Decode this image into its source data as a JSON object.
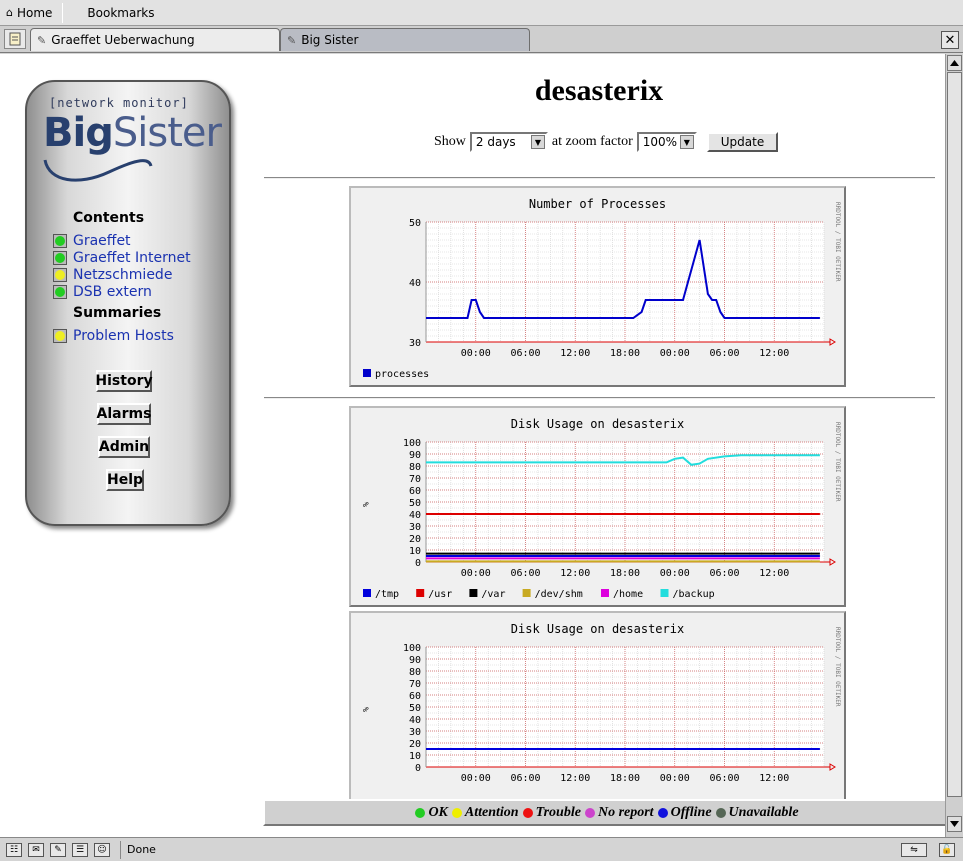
{
  "toolbar": {
    "home_label": "Home",
    "bookmarks_label": "Bookmarks"
  },
  "tabs": [
    {
      "label": "Graeffet Ueberwachung",
      "active": true
    },
    {
      "label": "Big Sister",
      "active": false
    }
  ],
  "sidebar": {
    "logo_tagline": "[network monitor]",
    "logo_big": "Big",
    "logo_sister": "Sister",
    "contents_heading": "Contents",
    "contents": [
      {
        "label": "Graeffet",
        "status_color": "#22cc22"
      },
      {
        "label": "Graeffet Internet",
        "status_color": "#22cc22"
      },
      {
        "label": "Netzschmiede",
        "status_color": "#eeee22"
      },
      {
        "label": "DSB extern",
        "status_color": "#22cc22"
      }
    ],
    "summaries_heading": "Summaries",
    "summaries": [
      {
        "label": "Problem Hosts",
        "status_color": "#eeee22"
      }
    ],
    "buttons": [
      "History",
      "Alarms",
      "Admin",
      "Help"
    ]
  },
  "main": {
    "host": "desasterix",
    "show_label": "Show",
    "range_value": "2 days",
    "zoom_label": "at zoom factor",
    "zoom_value": "100%",
    "update_label": "Update"
  },
  "status_legend": [
    {
      "label": "OK",
      "color": "#22cc22"
    },
    {
      "label": "Attention",
      "color": "#eeee00"
    },
    {
      "label": "Trouble",
      "color": "#ee1111"
    },
    {
      "label": "No report",
      "color": "#cc44cc"
    },
    {
      "label": "Offline",
      "color": "#1111dd"
    },
    {
      "label": "Unavailable",
      "color": "#556655"
    }
  ],
  "statusbar": {
    "text": "Done"
  },
  "chart_data": [
    {
      "type": "line",
      "title": "Number of Processes",
      "side_label": "RRDTOOL / TOBI OETIKER",
      "ylabel": "",
      "ylim": [
        30,
        50
      ],
      "y_ticks": [
        30,
        40,
        50
      ],
      "x_ticks": [
        "00:00",
        "06:00",
        "12:00",
        "18:00",
        "00:00",
        "06:00",
        "12:00"
      ],
      "series": [
        {
          "name": "processes",
          "color": "#0000cc",
          "x": [
            0,
            1,
            2,
            3,
            4,
            5,
            5.5,
            6,
            6.5,
            7,
            8,
            10,
            12,
            14,
            16,
            18,
            20,
            22,
            24,
            25,
            26,
            26.5,
            27,
            28,
            29,
            30,
            31,
            32,
            33,
            34,
            34.5,
            35,
            35.5,
            36,
            37,
            38,
            40,
            42,
            44,
            46,
            47.5
          ],
          "y": [
            34,
            34,
            34,
            34,
            34,
            34,
            37,
            37,
            35,
            34,
            34,
            34,
            34,
            34,
            34,
            34,
            34,
            34,
            34,
            34,
            35,
            37,
            37,
            37,
            37,
            37,
            37,
            42,
            47,
            38,
            37,
            37,
            35,
            34,
            34,
            34,
            34,
            34,
            34,
            34,
            34
          ]
        }
      ]
    },
    {
      "type": "line",
      "title": "Disk Usage on desasterix",
      "side_label": "RRDTOOL / TOBI OETIKER",
      "ylabel": "%",
      "ylim": [
        0,
        100
      ],
      "y_ticks": [
        0,
        10,
        20,
        30,
        40,
        50,
        60,
        70,
        80,
        90,
        100
      ],
      "x_ticks": [
        "00:00",
        "06:00",
        "12:00",
        "18:00",
        "00:00",
        "06:00",
        "12:00"
      ],
      "series": [
        {
          "name": "/tmp",
          "color": "#0000dd",
          "x": [
            0,
            47.5
          ],
          "y": [
            5,
            5
          ]
        },
        {
          "name": "/usr",
          "color": "#dd0000",
          "x": [
            0,
            47.5
          ],
          "y": [
            40,
            40
          ]
        },
        {
          "name": "/var",
          "color": "#000000",
          "x": [
            0,
            47.5
          ],
          "y": [
            7,
            7
          ]
        },
        {
          "name": "/dev/shm",
          "color": "#c8aa22",
          "x": [
            0,
            47.5
          ],
          "y": [
            0.5,
            0.5
          ]
        },
        {
          "name": "/home",
          "color": "#dd00dd",
          "x": [
            0,
            47.5
          ],
          "y": [
            3,
            3
          ]
        },
        {
          "name": "/backup",
          "color": "#22dddd",
          "x": [
            0,
            29,
            30,
            31,
            32,
            33,
            34,
            36,
            38,
            47.5
          ],
          "y": [
            83,
            83,
            86,
            87,
            81,
            82,
            86,
            88,
            89,
            89
          ]
        }
      ]
    },
    {
      "type": "line",
      "title": "Disk Usage on desasterix",
      "side_label": "RRDTOOL / TOBI OETIKER",
      "ylabel": "%",
      "ylim": [
        0,
        100
      ],
      "y_ticks": [
        0,
        10,
        20,
        30,
        40,
        50,
        60,
        70,
        80,
        90,
        100
      ],
      "x_ticks": [
        "00:00",
        "06:00",
        "12:00",
        "18:00",
        "00:00",
        "06:00",
        "12:00"
      ],
      "series": [
        {
          "name": "",
          "color": "#0000dd",
          "x": [
            0,
            47.5
          ],
          "y": [
            15,
            15
          ]
        }
      ]
    }
  ]
}
